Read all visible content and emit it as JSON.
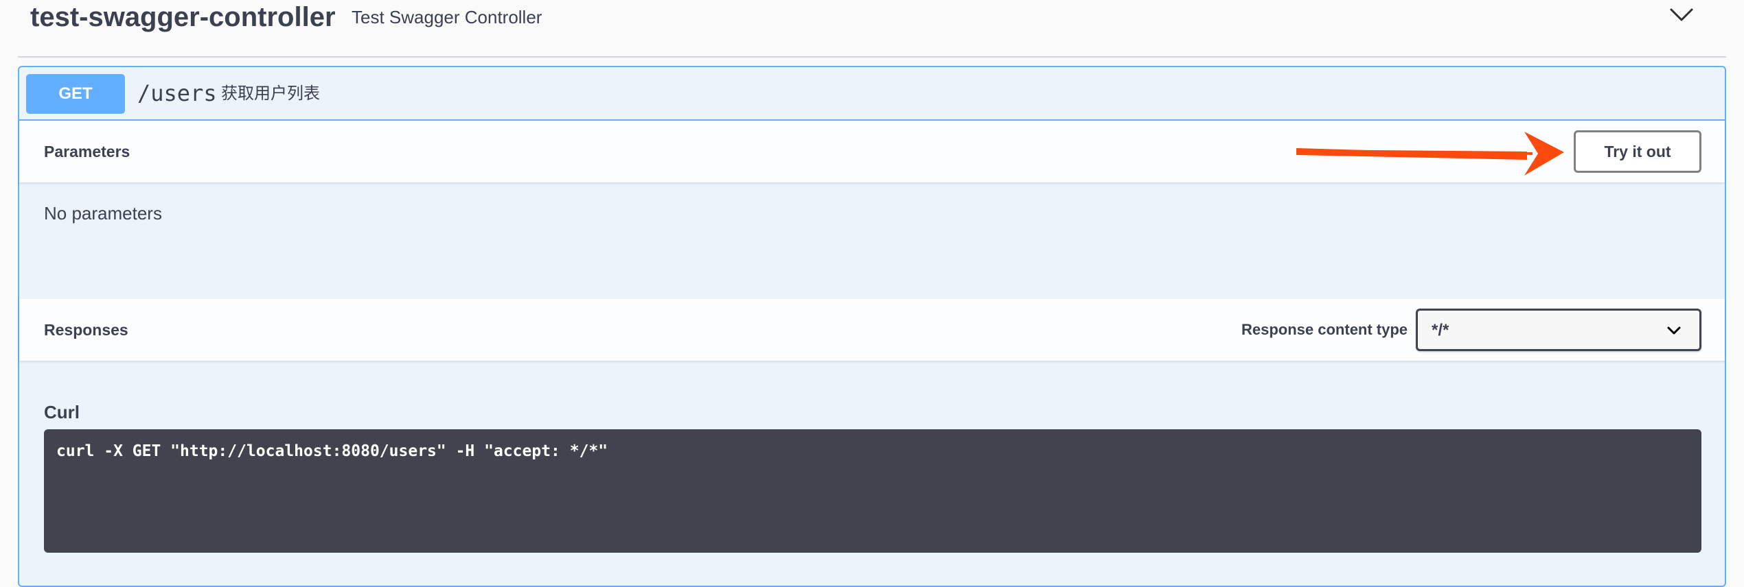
{
  "tag": {
    "name": "test-swagger-controller",
    "description": "Test Swagger Controller"
  },
  "operation": {
    "method": "GET",
    "path": "/users",
    "summary": "获取用户列表"
  },
  "parameters": {
    "title": "Parameters",
    "try_it_out_label": "Try it out",
    "empty_text": "No parameters"
  },
  "responses": {
    "title": "Responses",
    "content_type_label": "Response content type",
    "content_type_value": "*/*"
  },
  "curl": {
    "label": "Curl",
    "command": "curl -X GET \"http://localhost:8080/users\" -H \"accept: */*\""
  },
  "colors": {
    "get_method": "#61affe",
    "annotation_arrow": "#fa4a0e",
    "curl_background": "#41444e"
  },
  "icons": {
    "tag_toggle": "chevron-down-icon",
    "select_toggle": "chevron-down-icon",
    "annotation": "arrow-right-icon"
  }
}
